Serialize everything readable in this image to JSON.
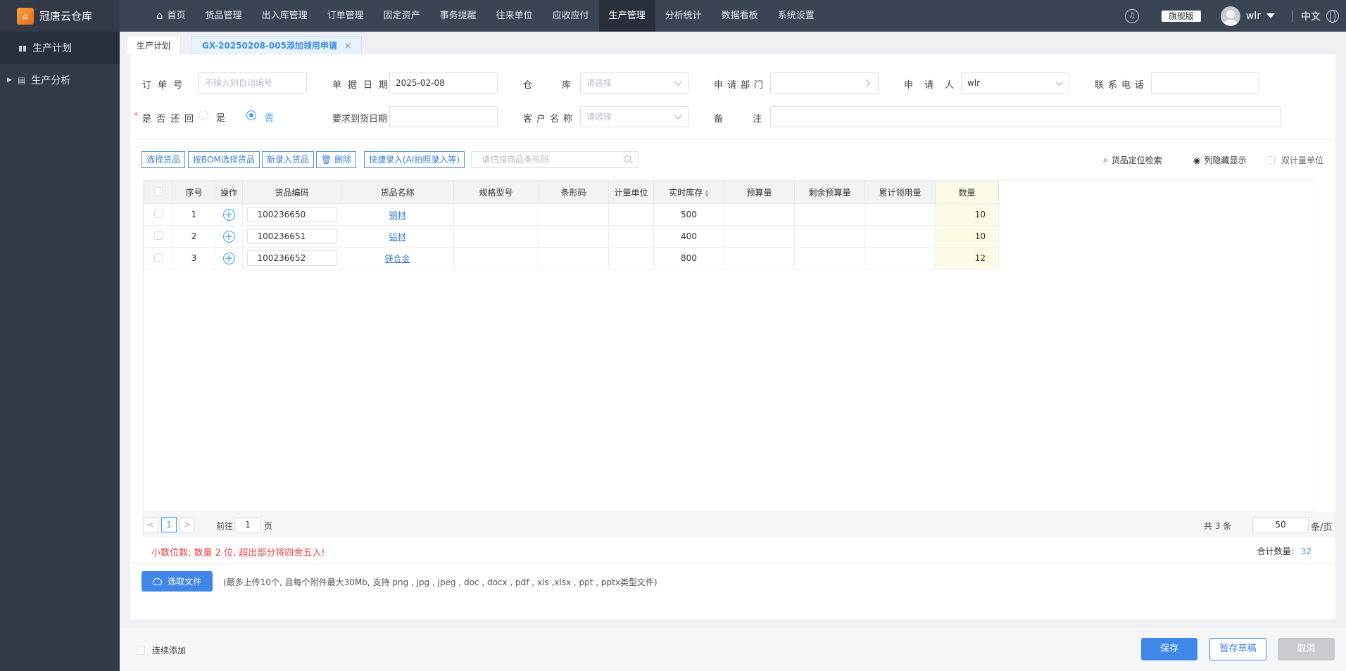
{
  "app": {
    "name": "冠唐云仓库",
    "logo": "house-logo"
  },
  "nav": [
    {
      "label": "首页",
      "icon": "home-icon"
    },
    {
      "label": "货品管理"
    },
    {
      "label": "出入库管理"
    },
    {
      "label": "订单管理"
    },
    {
      "label": "固定资产"
    },
    {
      "label": "事务提醒"
    },
    {
      "label": "往来单位"
    },
    {
      "label": "应收应付"
    },
    {
      "label": "生产管理",
      "active": true
    },
    {
      "label": "分析统计"
    },
    {
      "label": "数据看板"
    },
    {
      "label": "系统设置"
    }
  ],
  "header": {
    "edition": "旗舰版",
    "user": "wlr",
    "lang": "中文"
  },
  "sidebar": {
    "items": [
      {
        "label": "生产计划",
        "icon": "bar-chart-icon"
      },
      {
        "label": "生产分析",
        "icon": "document-icon"
      }
    ]
  },
  "tabs": [
    {
      "label": "生产计划"
    },
    {
      "label": "GX-20250208-005添加领用申请",
      "close": "×",
      "active": true
    }
  ],
  "form": {
    "order_no_label": "订单号",
    "order_no_placeholder": "不输入则自动编号",
    "doc_date_label": "单据日期",
    "doc_date_value": "2025-02-08",
    "warehouse_label": "仓库",
    "warehouse_placeholder": "请选择",
    "dept_label": "申请部门",
    "applicant_label": "申请人",
    "applicant_value": "wlr",
    "phone_label": "联系电话",
    "return_label": "是否还回",
    "return_yes": "是",
    "return_no": "否",
    "arrival_label": "要求到货日期",
    "customer_label": "客户名称",
    "customer_placeholder": "请选择",
    "remark_label": "备注"
  },
  "toolbar": {
    "buttons": [
      "选择货品",
      "按BOM选择货品",
      "新录入货品",
      "删除",
      "快捷录入(AI拍照录入等)"
    ],
    "scan_placeholder": "请扫描商品条形码",
    "locate": "货品定位检索",
    "col_toggle": "列隐藏显示",
    "dual_unit": "双计量单位"
  },
  "table": {
    "headers": [
      "序号",
      "操作",
      "货品编码",
      "货品名称",
      "规格型号",
      "条形码",
      "计量单位",
      "实时库存",
      "预算量",
      "剩余预算量",
      "累计领用量",
      "数量"
    ],
    "rows": [
      {
        "no": "1",
        "code": "100236650",
        "name": "钢材",
        "spec": "",
        "barcode": "",
        "unit": "",
        "stock": "500",
        "budget": "",
        "remain": "",
        "used": "",
        "qty": "10"
      },
      {
        "no": "2",
        "code": "100236651",
        "name": "铝材",
        "spec": "",
        "barcode": "",
        "unit": "",
        "stock": "400",
        "budget": "",
        "remain": "",
        "used": "",
        "qty": "10"
      },
      {
        "no": "3",
        "code": "100236652",
        "name": "镁合金",
        "spec": "",
        "barcode": "",
        "unit": "",
        "stock": "800",
        "budget": "",
        "remain": "",
        "used": "",
        "qty": "12"
      }
    ]
  },
  "pager": {
    "prev": "<",
    "page": "1",
    "next": ">",
    "goto_prefix": "前往",
    "goto_value": "1",
    "goto_suffix": "页",
    "total": "共 3 条",
    "page_size": "50",
    "page_size_suffix": "条/页"
  },
  "notes": {
    "decimal": "小数位数: 数量 2 位, 超出部分将四舍五入!",
    "total_label": "合计数量:",
    "total_value": "32"
  },
  "upload": {
    "button": "选取文件",
    "hint": "(最多上传10个, 且每个附件最大30Mb, 支持 png , jpg , jpeg , doc , docx , pdf , xls ,xlsx , ppt , pptx类型文件)"
  },
  "footer": {
    "continuous": "连续添加",
    "save": "保存",
    "draft": "暂存草稿",
    "cancel": "取消"
  },
  "colors": {
    "primary": "#4187ea",
    "nav_bg": "#3b4453",
    "sidebar_bg": "#323a48",
    "warning": "#f24040"
  }
}
